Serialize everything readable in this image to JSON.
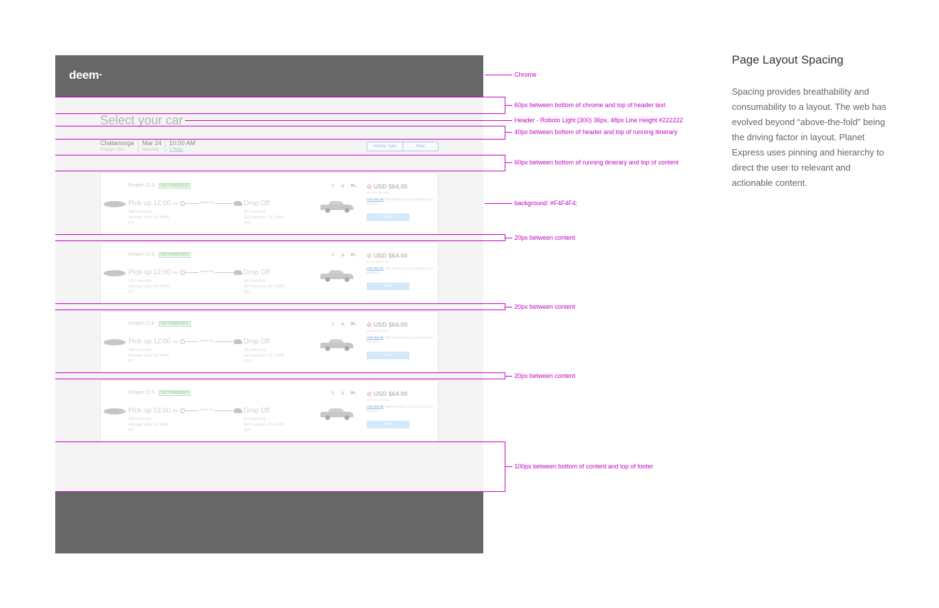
{
  "mock": {
    "logo": "deem",
    "logo_mark": "·",
    "header": "Select your car",
    "itinerary": {
      "city": "Chatanooga",
      "location": "Orange | Bko",
      "date": "Mar 24",
      "day": "Saturday",
      "time": "10:00 AM",
      "stops": "2 Stops"
    },
    "sort": [
      "Vehicle Type",
      "Rate"
    ]
  },
  "cards": [
    {
      "name": "Empire CLS",
      "badge": "RECOMMENDED",
      "icons": "⚙ ♟ ⛟",
      "pickup": "Pick-up 12:00",
      "pm": "PM",
      "pickup_addr": [
        "408 Freres Ave",
        "Mountain View, CA, 94040",
        "PIT"
      ],
      "duration": "30 Min Sel",
      "dropoff": "Drop Off",
      "dropoff_addr": [
        "901 Verreni St",
        "San Francisco, CA, 94105",
        "SFO"
      ],
      "price": "USD $64.00",
      "price_sub": "per hour (3hr min)",
      "total_amount": "USD $91.55",
      "total_text": "Total estimated cost including taxes and fees",
      "select": "Select"
    },
    {
      "name": "Empire CLS",
      "badge": "RECOMMENDED",
      "icons": "⚙ ♟ ⛟",
      "pickup": "Pick-up 12:00",
      "pm": "PM",
      "pickup_addr": [
        "408 Freres Ave",
        "Mountain View, CA, 94040",
        "PIT"
      ],
      "duration": "30 Min Sel",
      "dropoff": "Drop Off",
      "dropoff_addr": [
        "901 Verreni St",
        "San Francisco, CA, 94105",
        "SFO"
      ],
      "price": "USD $64.00",
      "price_sub": "per hour (3hr min)",
      "total_amount": "USD $91.55",
      "total_text": "Total estimated cost including taxes and fees",
      "select": "Select"
    },
    {
      "name": "Empire CLS",
      "badge": "RECOMMENDED",
      "icons": "⚙ ♟ ⛟",
      "pickup": "Pick-up 12:00",
      "pm": "PM",
      "pickup_addr": [
        "408 Freres Ave",
        "Mountain View, CA, 94040",
        "PIT"
      ],
      "duration": "30 Min Sel",
      "dropoff": "Drop Off",
      "dropoff_addr": [
        "901 Verreni St",
        "San Francisco, CA, 94105",
        "SFO"
      ],
      "price": "USD $64.00",
      "price_sub": "per hour (3hr min)",
      "total_amount": "USD $91.55",
      "total_text": "Total estimated cost including taxes and fees",
      "select": "Select"
    },
    {
      "name": "Empire CLS",
      "badge": "RECOMMENDED",
      "icons": "⚙ ♟ ⛟",
      "pickup": "Pick-up 12:00",
      "pm": "PM",
      "pickup_addr": [
        "408 Freres Ave",
        "Mountain View, CA, 94040",
        "PIT"
      ],
      "duration": "30 Min Sel",
      "dropoff": "Drop Off",
      "dropoff_addr": [
        "901 Verreni St",
        "San Francisco, CA, 94105",
        "SFO"
      ],
      "price": "USD $64.00",
      "price_sub": "per hour (3hr min)",
      "total_amount": "USD $91.55",
      "total_text": "Total estimated cost including taxes and fees",
      "select": "Select"
    }
  ],
  "annotations": {
    "chrome": "Chrome",
    "header_gap": "60px between bottom of chrome and top of header text",
    "header_spec": "Header - Roboto Light (300)   36px, 48px Line Height   #222222",
    "itinerary_gap": "40px between bottom of header and top of running itinerary",
    "content_gap": "60px between bottom of running itinerary and  top of content",
    "background": "background: #F4F4F4;",
    "between_1": "20px between content",
    "between_2": "20px between content",
    "between_3": "20px between content",
    "footer_gap": "100px between bottom of content and top of footer"
  },
  "side": {
    "title": "Page Layout Spacing",
    "body": "Spacing provides breathability and consumability to a layout. The web has evolved beyond “above-the-fold” being the driving factor in layout. Planet Express uses pinning and hierarchy to direct the user to relevant and actionable content."
  },
  "colors": {
    "chrome": "#676767",
    "background": "#F4F4F4",
    "annotation": "#C400C4",
    "header_text": "#222222"
  }
}
